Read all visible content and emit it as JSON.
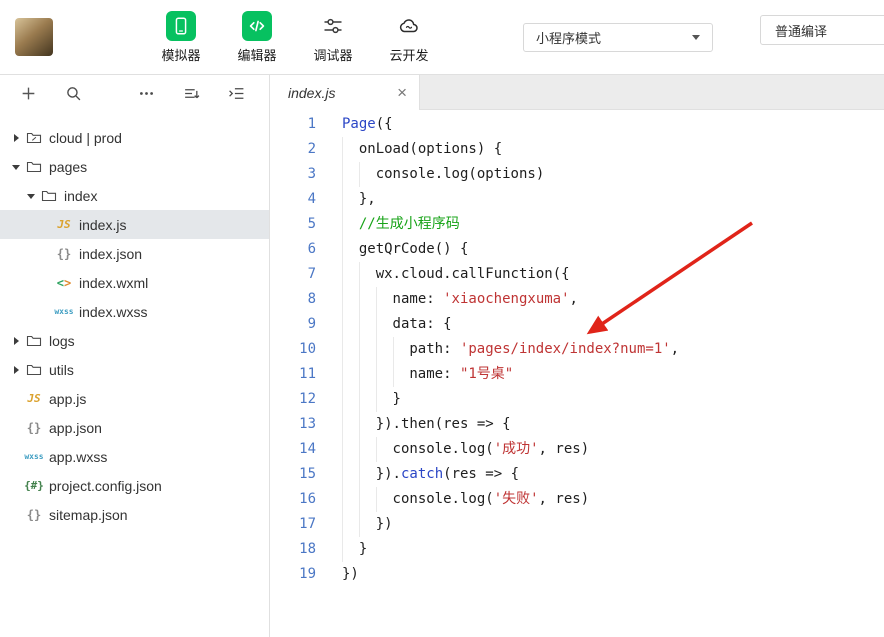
{
  "colors": {
    "brand_green": "#07c160",
    "keyword_blue": "#2b46c6",
    "string_red": "#bf3434",
    "comment_green": "#17a317",
    "line_number_blue": "#4b77c5",
    "arrow_red": "#e02419",
    "selected_row_bg": "#e4e7ea"
  },
  "titlebar": {
    "nav_buttons": [
      {
        "id": "simulator",
        "label": "模拟器",
        "active": true
      },
      {
        "id": "editor",
        "label": "编辑器",
        "active": true
      },
      {
        "id": "debugger",
        "label": "调试器",
        "active": false
      },
      {
        "id": "cloud",
        "label": "云开发",
        "active": false
      }
    ],
    "mode_dropdown": "小程序模式",
    "compile_dropdown": "普通编译"
  },
  "explorer": {
    "toolbar_icons": [
      "new-file",
      "search",
      "more-actions",
      "sort-files",
      "collapse-folders"
    ],
    "items": [
      {
        "label": "cloud | prod",
        "icon": "cloudfolder",
        "depth": 0,
        "arrow": "collapsed"
      },
      {
        "label": "pages",
        "icon": "folder",
        "depth": 0,
        "arrow": "expanded"
      },
      {
        "label": "index",
        "icon": "folder",
        "depth": 1,
        "arrow": "expanded"
      },
      {
        "label": "index.js",
        "icon": "js",
        "depth": 2,
        "selected": true
      },
      {
        "label": "index.json",
        "icon": "json",
        "depth": 2
      },
      {
        "label": "index.wxml",
        "icon": "wxml",
        "depth": 2
      },
      {
        "label": "index.wxss",
        "icon": "wxss",
        "depth": 2
      },
      {
        "label": "logs",
        "icon": "folder",
        "depth": 0,
        "arrow": "collapsed"
      },
      {
        "label": "utils",
        "icon": "folder",
        "depth": 0,
        "arrow": "collapsed"
      },
      {
        "label": "app.js",
        "icon": "js",
        "depth": 0
      },
      {
        "label": "app.json",
        "icon": "json",
        "depth": 0
      },
      {
        "label": "app.wxss",
        "icon": "wxss",
        "depth": 0
      },
      {
        "label": "project.config.json",
        "icon": "config",
        "depth": 0
      },
      {
        "label": "sitemap.json",
        "icon": "json",
        "depth": 0
      }
    ]
  },
  "editor": {
    "tab": {
      "title": "index.js",
      "close_icon": "×"
    },
    "lines": [
      {
        "n": "1",
        "indent": 0,
        "tokens": [
          {
            "c": "blue",
            "t": "Page"
          },
          {
            "c": "p",
            "t": "({"
          }
        ]
      },
      {
        "n": "2",
        "indent": 2,
        "tokens": [
          {
            "c": "p",
            "t": "onLoad(options) {"
          }
        ]
      },
      {
        "n": "3",
        "indent": 4,
        "tokens": [
          {
            "c": "p",
            "t": "console.log(options)"
          }
        ]
      },
      {
        "n": "4",
        "indent": 2,
        "tokens": [
          {
            "c": "p",
            "t": "},"
          }
        ]
      },
      {
        "n": "5",
        "indent": 2,
        "tokens": [
          {
            "c": "com",
            "t": "//生成小程序码"
          }
        ]
      },
      {
        "n": "6",
        "indent": 2,
        "tokens": [
          {
            "c": "p",
            "t": "getQrCode() {"
          }
        ]
      },
      {
        "n": "7",
        "indent": 4,
        "tokens": [
          {
            "c": "p",
            "t": "wx.cloud.callFunction({"
          }
        ]
      },
      {
        "n": "8",
        "indent": 6,
        "tokens": [
          {
            "c": "p",
            "t": "name: "
          },
          {
            "c": "str",
            "t": "'xiaochengxuma'"
          },
          {
            "c": "p",
            "t": ","
          }
        ]
      },
      {
        "n": "9",
        "indent": 6,
        "tokens": [
          {
            "c": "p",
            "t": "data: {"
          }
        ]
      },
      {
        "n": "10",
        "indent": 8,
        "tokens": [
          {
            "c": "p",
            "t": "path: "
          },
          {
            "c": "str",
            "t": "'pages/index/index?num=1'"
          },
          {
            "c": "p",
            "t": ","
          }
        ]
      },
      {
        "n": "11",
        "indent": 8,
        "tokens": [
          {
            "c": "p",
            "t": "name: "
          },
          {
            "c": "str",
            "t": "\"1号桌\""
          }
        ]
      },
      {
        "n": "12",
        "indent": 6,
        "tokens": [
          {
            "c": "p",
            "t": "}"
          }
        ]
      },
      {
        "n": "13",
        "indent": 4,
        "tokens": [
          {
            "c": "p",
            "t": "}).then(res => {"
          }
        ]
      },
      {
        "n": "14",
        "indent": 6,
        "tokens": [
          {
            "c": "p",
            "t": "console.log("
          },
          {
            "c": "str",
            "t": "'成功'"
          },
          {
            "c": "p",
            "t": ", res)"
          }
        ]
      },
      {
        "n": "15",
        "indent": 4,
        "tokens": [
          {
            "c": "p",
            "t": "})."
          },
          {
            "c": "blue",
            "t": "catch"
          },
          {
            "c": "p",
            "t": "(res => {"
          }
        ]
      },
      {
        "n": "16",
        "indent": 6,
        "tokens": [
          {
            "c": "p",
            "t": "console.log("
          },
          {
            "c": "str",
            "t": "'失败'"
          },
          {
            "c": "p",
            "t": ", res)"
          }
        ]
      },
      {
        "n": "17",
        "indent": 4,
        "tokens": [
          {
            "c": "p",
            "t": "})"
          }
        ]
      },
      {
        "n": "18",
        "indent": 2,
        "tokens": [
          {
            "c": "p",
            "t": "}"
          }
        ]
      },
      {
        "n": "19",
        "indent": 0,
        "tokens": [
          {
            "c": "p",
            "t": "})"
          }
        ]
      }
    ]
  }
}
